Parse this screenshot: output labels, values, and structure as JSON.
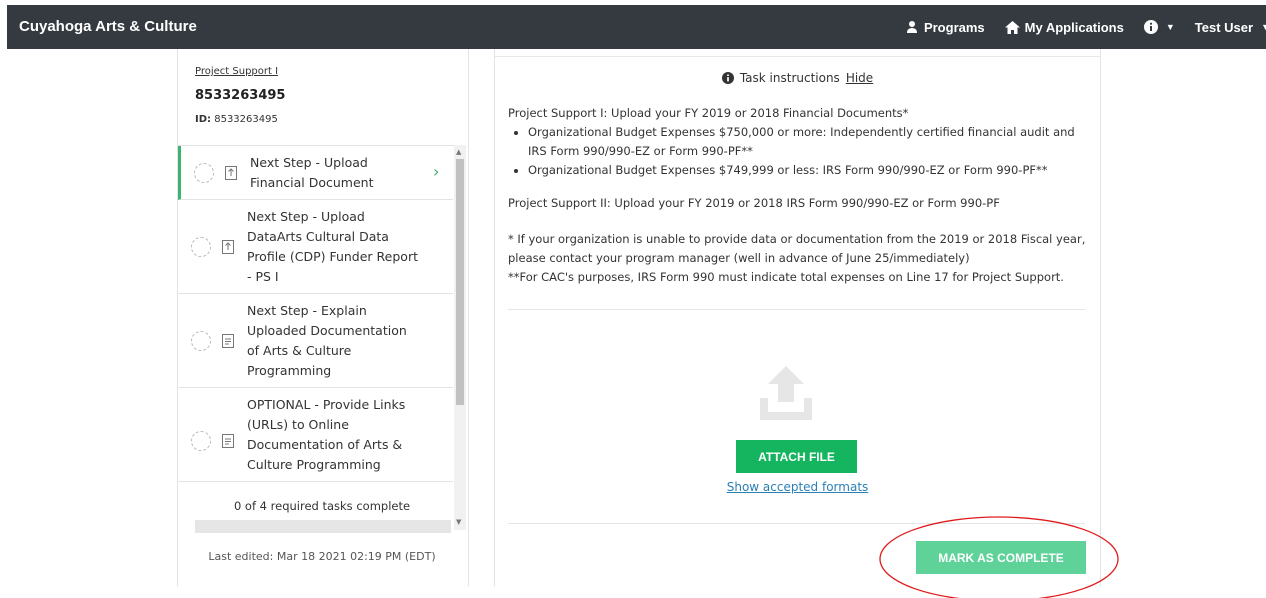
{
  "navbar": {
    "brand": "Cuyahoga Arts & Culture",
    "programs_label": "Programs",
    "my_applications_label": "My Applications",
    "user_label": "Test User",
    "bg_color": "#343a40"
  },
  "sidebar": {
    "project_link": "Project Support I",
    "project_name": "8533263495",
    "id_label": "ID:",
    "id_value": "8533263495",
    "tasks": [
      {
        "label": "Next Step - Upload Financial Document",
        "icon": "upload-file-icon",
        "active": true
      },
      {
        "label": "Next Step - Upload DataArts Cultural Data Profile (CDP) Funder Report - PS I",
        "icon": "upload-file-icon",
        "active": false
      },
      {
        "label": "Next Step - Explain Uploaded Documentation of Arts & Culture Programming",
        "icon": "document-icon",
        "active": false
      },
      {
        "label": "OPTIONAL - Provide Links (URLs) to Online Documentation of Arts & Culture Programming",
        "icon": "document-icon",
        "active": false
      }
    ],
    "progress_text": "0 of 4 required tasks complete",
    "progress_fraction": 0,
    "last_edited": "Last edited: Mar 18 2021 02:19 PM (EDT)"
  },
  "main": {
    "instructions_title": "Task instructions",
    "hide_label": "Hide",
    "intro_line": "Project Support I: Upload your FY 2019 or 2018 Financial Documents*",
    "bullet1": "Organizational Budget Expenses $750,000 or more: Independently certified financial audit and IRS Form 990/990-EZ or Form 990-PF**",
    "bullet2": "Organizational Budget Expenses $749,999 or less: IRS Form 990/990-EZ or Form 990-PF**",
    "ps2_line": "Project Support II: Upload your FY 2019 or 2018 IRS Form 990/990-EZ or Form 990-PF",
    "note1": "* If your organization is unable to provide data or documentation from the 2019 or 2018 Fiscal year, please contact your program manager (well in advance of June 25/immediately)",
    "note2": "**For CAC's purposes, IRS Form 990 must indicate total expenses on Line 17 for Project Support.",
    "attach_label": "ATTACH FILE",
    "formats_label": "Show accepted formats",
    "complete_label": "MARK AS COMPLETE",
    "accent_color": "#15b55f"
  }
}
